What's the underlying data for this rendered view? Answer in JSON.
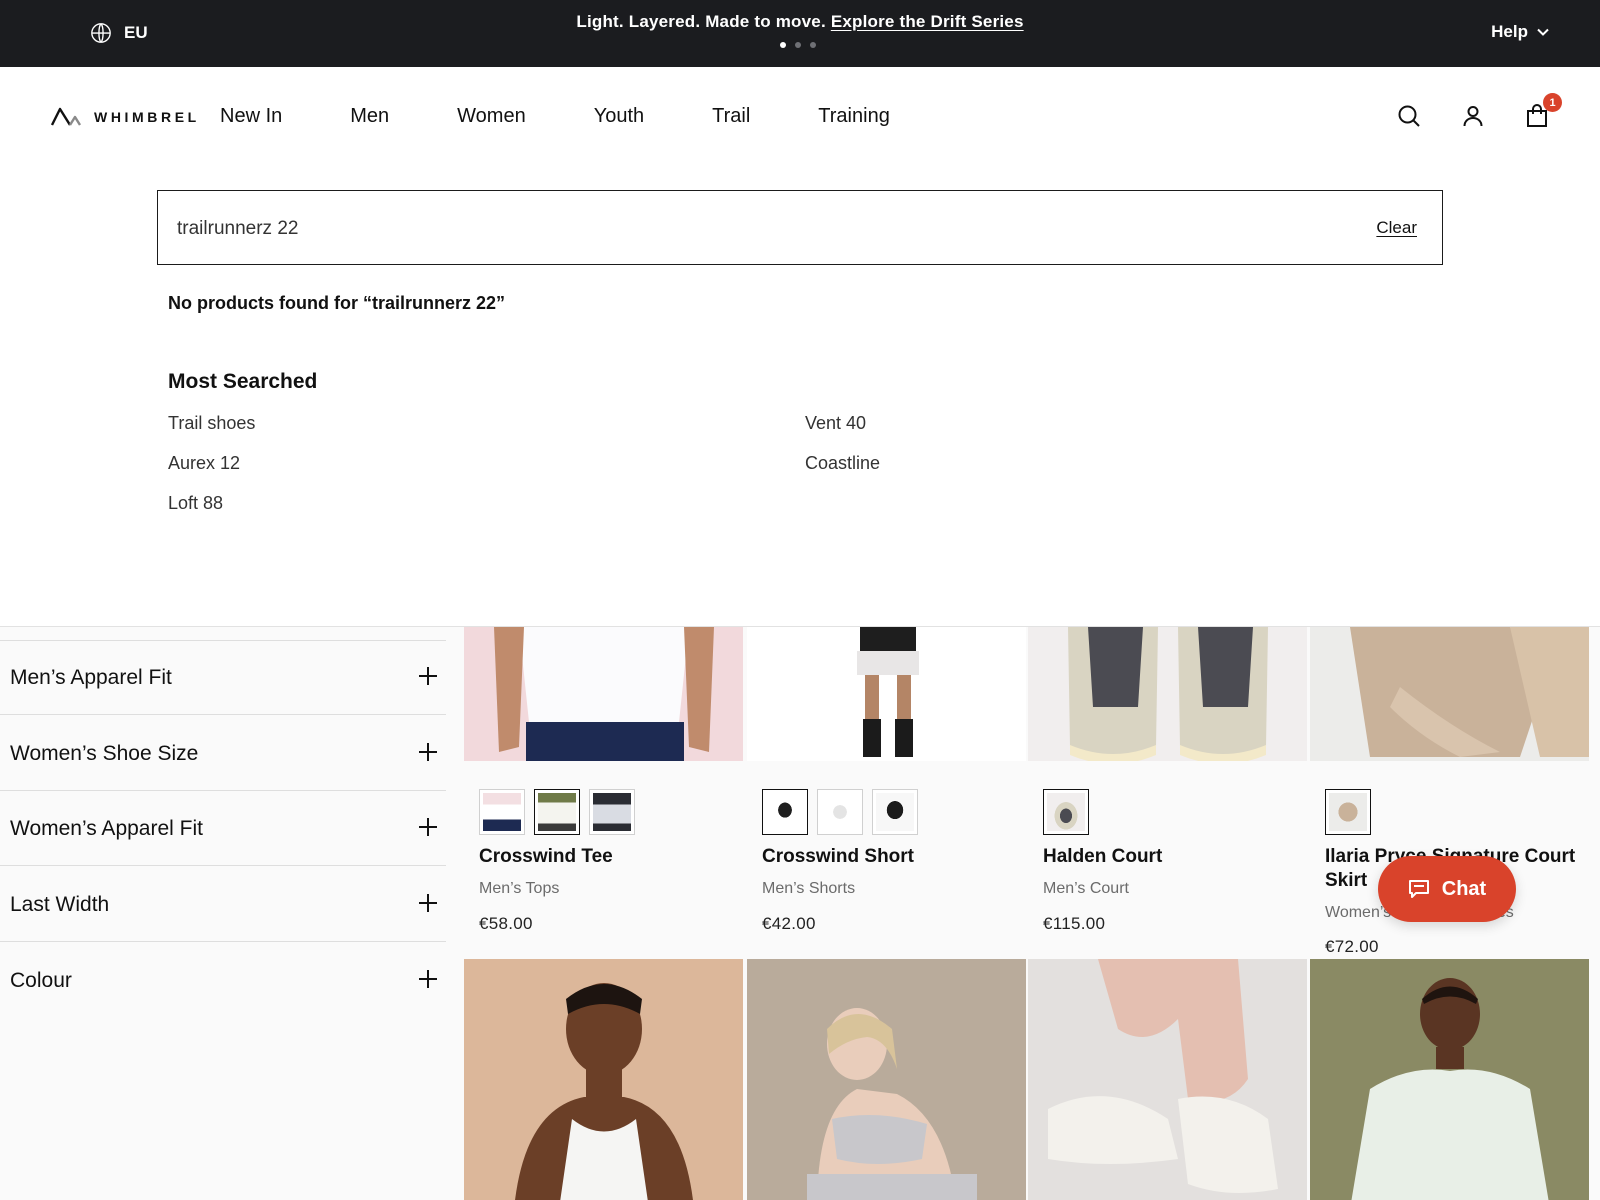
{
  "announcement": {
    "locale": "EU",
    "message": "Light. Layered. Made to move.",
    "link": "Explore the Drift Series",
    "help": "Help"
  },
  "header": {
    "brand": "WHIMBREL",
    "nav": [
      "New In",
      "Men",
      "Women",
      "Youth",
      "Trail",
      "Training"
    ],
    "cart_count": "1"
  },
  "search": {
    "query": "trailrunnerz 22",
    "clear": "Clear",
    "no_results": "No products found for “trailrunnerz 22”",
    "most_searched_title": "Most Searched",
    "most_searched": [
      "Trail shoes",
      "Vent 40",
      "Aurex 12",
      "Coastline",
      "Loft 88"
    ]
  },
  "filters": [
    "Men’s Apparel Fit",
    "Women’s Shoe Size",
    "Women’s Apparel Fit",
    "Last Width",
    "Colour"
  ],
  "products": [
    {
      "name": "Crosswind Tee",
      "category": "Men’s Tops",
      "price": "€58.00"
    },
    {
      "name": "Crosswind Short",
      "category": "Men’s Shorts",
      "price": "€42.00"
    },
    {
      "name": "Halden Court",
      "category": "Men’s Court",
      "price": "€115.00"
    },
    {
      "name": "Ilaria Pryce Signature Court Skirt",
      "category": "Women’s Skirts & Dresses",
      "price": "€72.00"
    }
  ],
  "chat": {
    "label": "Chat"
  },
  "colors": {
    "accent": "#d9432b",
    "topbar": "#1b1c1f"
  }
}
